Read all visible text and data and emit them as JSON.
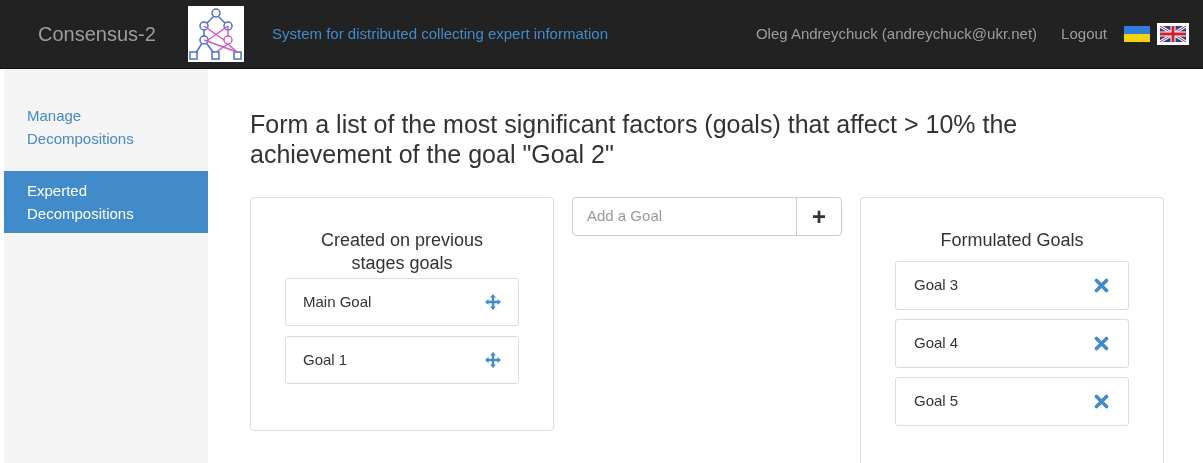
{
  "navbar": {
    "brand": "Consensus-2",
    "tagline": "System for distributed collecting expert information",
    "user": "Oleg Andreychuck (andreychuck@ukr.net)",
    "logout": "Logout",
    "languages": [
      {
        "kind": "ukraine",
        "selected": false
      },
      {
        "kind": "britain",
        "selected": true
      }
    ]
  },
  "sidebar": {
    "items": [
      {
        "label": "Manage Decompositions",
        "selected": false
      },
      {
        "label": "Experted Decompositions",
        "selected": true
      }
    ]
  },
  "title": "Form a list of the most significant factors (goals) that affect > 10% the achievement of the goal \"Goal 2\"",
  "previous_panel": {
    "heading": "Created on previous stages goals",
    "items": [
      "Main Goal",
      "Goal 1"
    ]
  },
  "add_goal": {
    "placeholder": "Add a Goal",
    "button": "+"
  },
  "formulated_panel": {
    "heading": "Formulated Goals",
    "items": [
      "Goal 3",
      "Goal 4",
      "Goal 5"
    ]
  }
}
